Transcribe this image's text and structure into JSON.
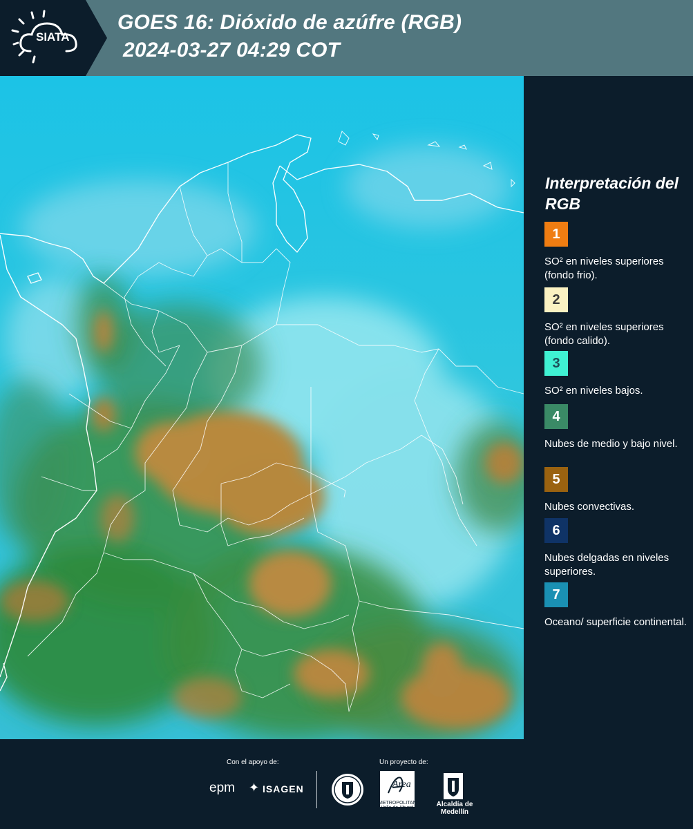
{
  "header": {
    "logo_text": "SIATA",
    "title_line1": "GOES 16: Dióxido de azúfre (RGB)",
    "title_line2": "2024-03-27 04:29 COT"
  },
  "legend": {
    "title": "Interpretación del RGB",
    "items": [
      {
        "number": "1",
        "color": "#f07d12",
        "text_color": "#ffffff",
        "description": "SO² en niveles superiores (fondo frio)."
      },
      {
        "number": "2",
        "color": "#fbf2c2",
        "text_color": "#3b3b3b",
        "description": "SO² en niveles superiores (fondo calido)."
      },
      {
        "number": "3",
        "color": "#3ff1d3",
        "text_color": "#1e4d57",
        "description": "SO² en niveles bajos."
      },
      {
        "number": "4",
        "color": "#3a8a66",
        "text_color": "#ffffff",
        "description": "Nubes de medio y bajo nivel."
      },
      {
        "number": "5",
        "color": "#9a6210",
        "text_color": "#ffffff",
        "description": "Nubes convectivas."
      },
      {
        "number": "6",
        "color": "#0f3366",
        "text_color": "#ffffff",
        "description": "Nubes delgadas en niveles superiores."
      },
      {
        "number": "7",
        "color": "#1a90b3",
        "text_color": "#ffffff",
        "description": "Oceano/ superficie continental."
      }
    ]
  },
  "footer": {
    "support_label": "Con el apoyo de:",
    "project_label": "Un proyecto de:",
    "sponsor_epm": "epm",
    "sponsor_isagen": "ISAGEN",
    "area_name": "Área",
    "area_caption": "METROPOLITANA Valle de Aburrá",
    "alcaldia": "Alcaldía de Medellín"
  },
  "colors": {
    "background": "#0c1d2b",
    "header_band": "#52777f",
    "ocean_cyan": "#22bfe0",
    "cloud_cyan": "#8fe3ef",
    "convective_tan": "#b8893e",
    "green_cloud": "#2f8a3a"
  }
}
